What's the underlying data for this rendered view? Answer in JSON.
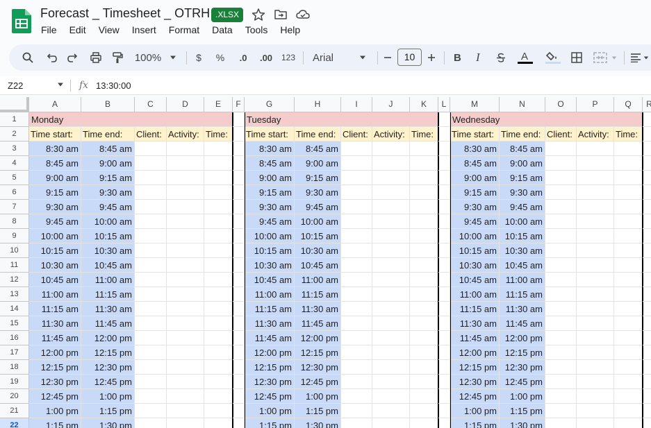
{
  "doc": {
    "title": "Forecast _ Timesheet _ OTRH",
    "badge": ".XLSX"
  },
  "menu": [
    "File",
    "Edit",
    "View",
    "Insert",
    "Format",
    "Data",
    "Tools",
    "Help"
  ],
  "toolbar": {
    "zoom": "100%",
    "currency": "$",
    "percent": "%",
    "decrease_decimal": ".0",
    "increase_decimal": ".00",
    "number_format": "123",
    "font": "Arial",
    "font_size": "10"
  },
  "formula_bar": {
    "cell_ref": "Z22",
    "value": "13:30:00"
  },
  "colors": {
    "day_header": "#f4cccc",
    "column_header": "#fff2cc",
    "time_cell": "#c9daf8",
    "badge": "#188038",
    "selection": "#0b57d0"
  },
  "icons": [
    "sheets-logo-icon",
    "star-icon",
    "move-folder-icon",
    "cloud-status-icon",
    "search-icon",
    "undo-icon",
    "redo-icon",
    "print-icon",
    "paint-format-icon",
    "chevron-down-icon",
    "minus-icon",
    "plus-icon",
    "bold-icon",
    "italic-icon",
    "strikethrough-icon",
    "text-color-icon",
    "fill-color-icon",
    "borders-icon",
    "merge-cells-icon",
    "align-icon"
  ],
  "sheet": {
    "columns": [
      "A",
      "B",
      "C",
      "D",
      "E",
      "F",
      "G",
      "H",
      "I",
      "J",
      "K",
      "L",
      "M",
      "N",
      "O",
      "P",
      "Q",
      "R"
    ],
    "rows": [
      "1",
      "2",
      "3",
      "4",
      "5",
      "6",
      "7",
      "8",
      "9",
      "10",
      "11",
      "12",
      "13",
      "14",
      "15",
      "16",
      "17",
      "18",
      "19",
      "20",
      "21",
      "22"
    ],
    "selected_row": "22",
    "days": [
      "Monday",
      "Tuesday",
      "Wednesday"
    ],
    "headers": [
      "Time start:",
      "Time end:",
      "Client:",
      "Activity:",
      "Time:"
    ],
    "time_start": [
      "8:30 am",
      "8:45 am",
      "9:00 am",
      "9:15 am",
      "9:30 am",
      "9:45 am",
      "10:00 am",
      "10:15 am",
      "10:30 am",
      "10:45 am",
      "11:00 am",
      "11:15 am",
      "11:30 am",
      "11:45 am",
      "12:00 pm",
      "12:15 pm",
      "12:30 pm",
      "12:45 pm",
      "1:00 pm",
      "1:15 pm"
    ],
    "time_end": [
      "8:45 am",
      "9:00 am",
      "9:15 am",
      "9:30 am",
      "9:45 am",
      "10:00 am",
      "10:15 am",
      "10:30 am",
      "10:45 am",
      "11:00 am",
      "11:15 am",
      "11:30 am",
      "11:45 am",
      "12:00 pm",
      "12:15 pm",
      "12:30 pm",
      "12:45 pm",
      "1:00 pm",
      "1:15 pm",
      "1:30 pm"
    ]
  }
}
